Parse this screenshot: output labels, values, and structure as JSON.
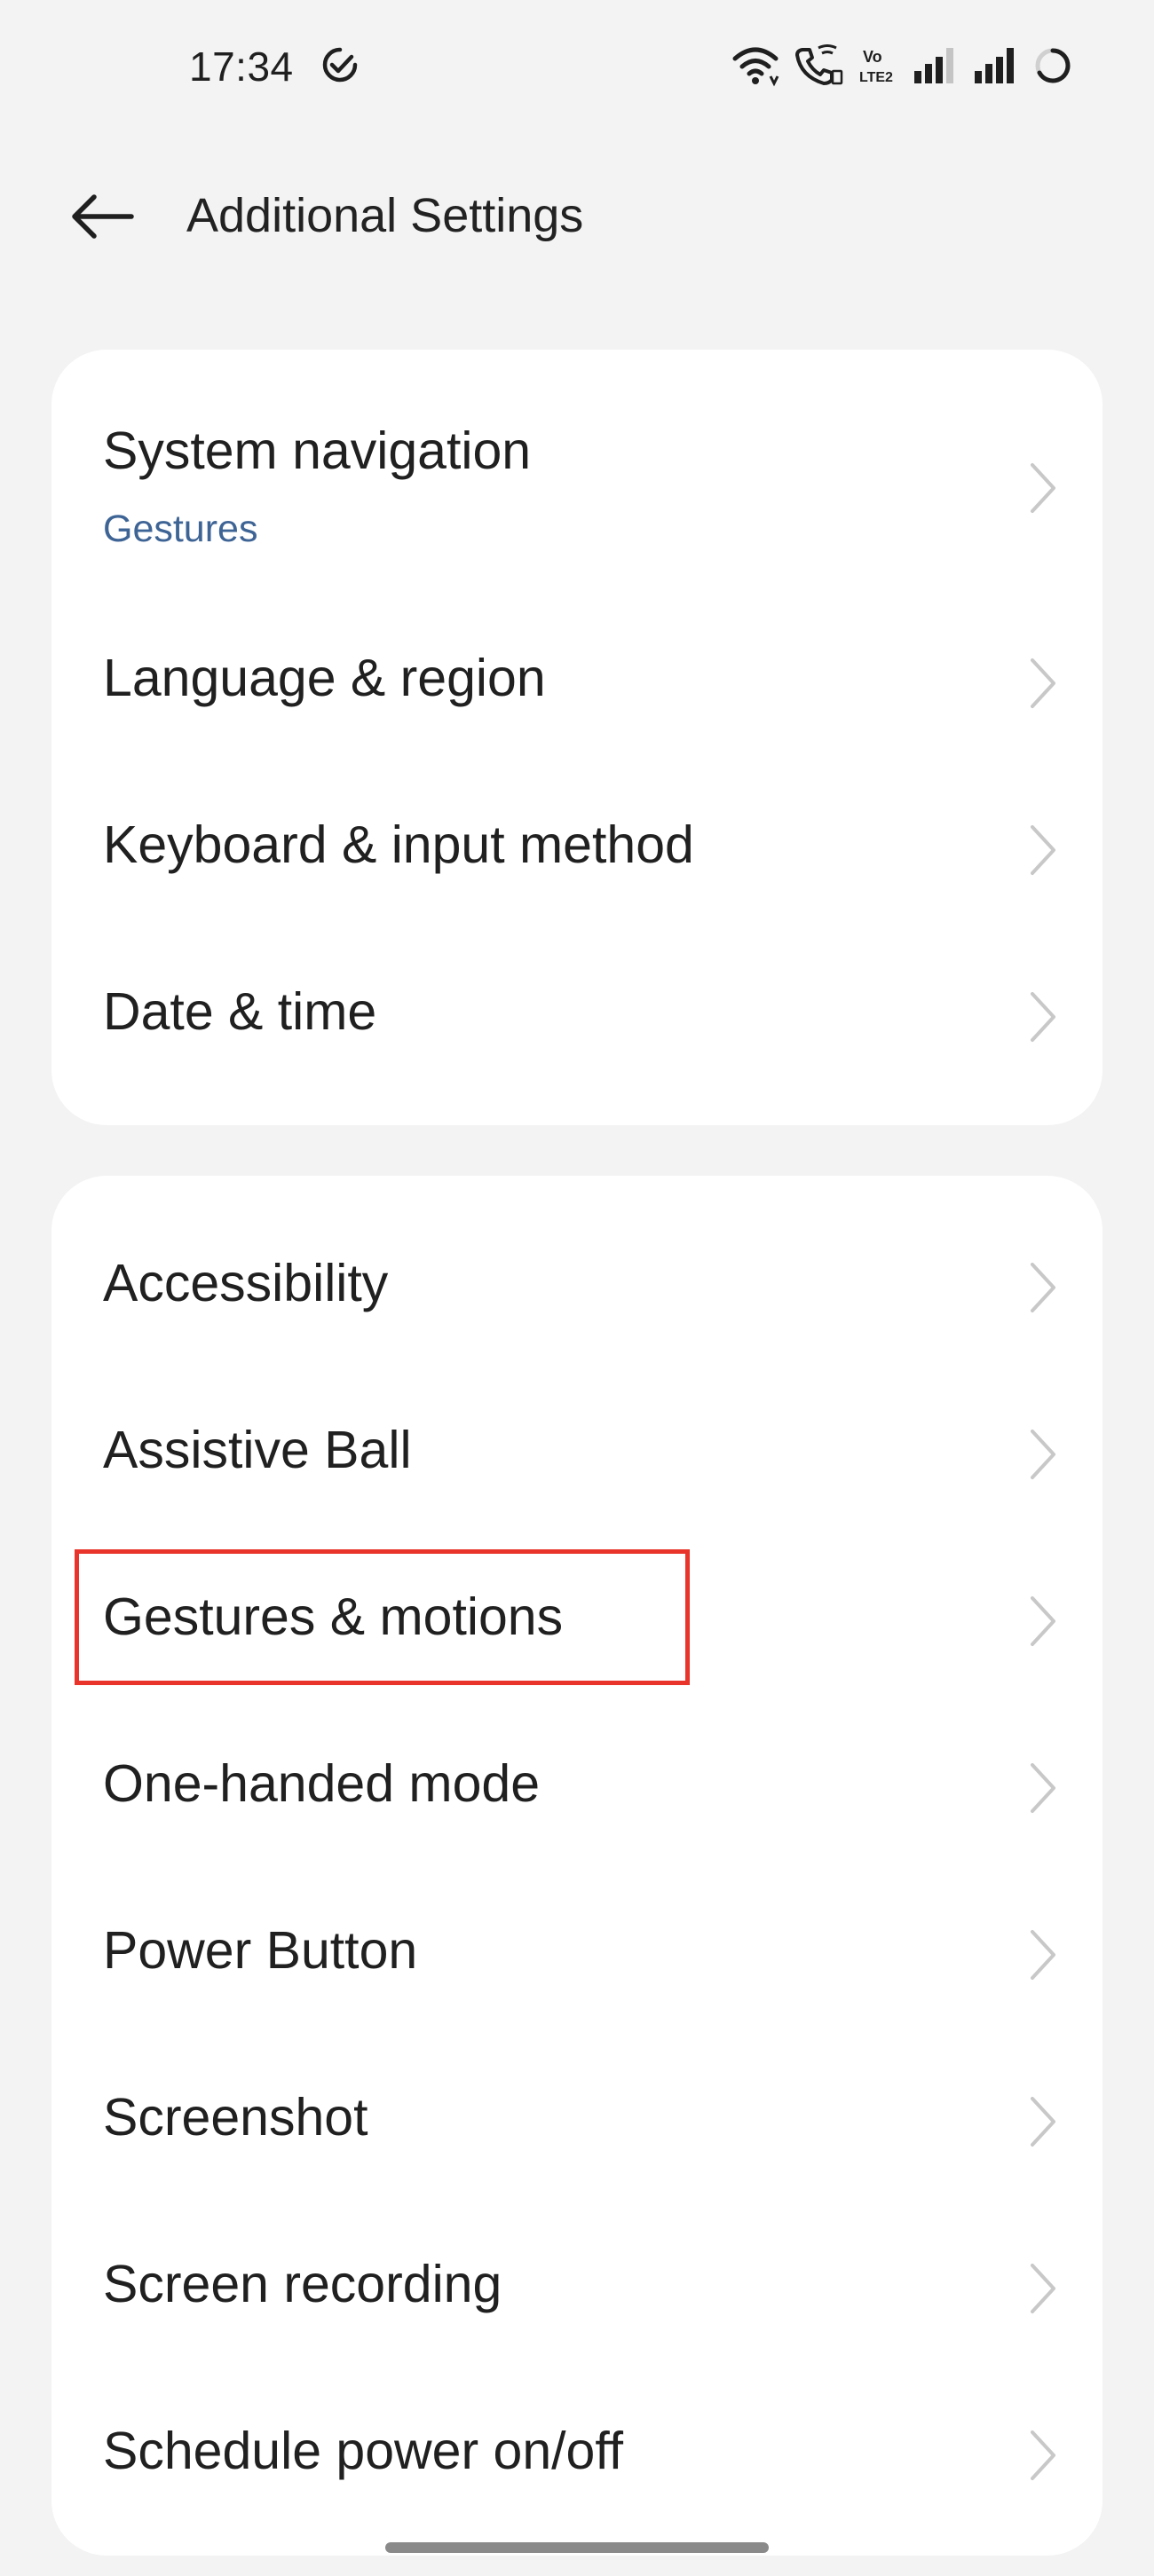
{
  "status_bar": {
    "time": "17:34",
    "icons": [
      "check-circle-icon",
      "wifi-icon",
      "wifi-calling-icon",
      "volte-icon",
      "signal-1-icon",
      "signal-2-icon",
      "loading-circle-icon"
    ],
    "volte_text": "Vo\nLTE2"
  },
  "header": {
    "back_icon": "back-arrow-icon",
    "title": "Additional Settings"
  },
  "groups": [
    {
      "items": [
        {
          "label": "System navigation",
          "value": "Gestures"
        },
        {
          "label": "Language & region"
        },
        {
          "label": "Keyboard & input method"
        },
        {
          "label": "Date & time"
        }
      ]
    },
    {
      "items": [
        {
          "label": "Accessibility"
        },
        {
          "label": "Assistive Ball"
        },
        {
          "label": "Gestures & motions",
          "highlighted": true
        },
        {
          "label": "One-handed mode"
        },
        {
          "label": "Power Button"
        },
        {
          "label": "Screenshot"
        },
        {
          "label": "Screen recording"
        },
        {
          "label": "Schedule power on/off"
        }
      ]
    }
  ],
  "colors": {
    "background": "#f3f3f3",
    "card": "#ffffff",
    "subtitle": "#3e6495",
    "highlight": "#e8342a",
    "chevron": "#c8c8c8"
  }
}
